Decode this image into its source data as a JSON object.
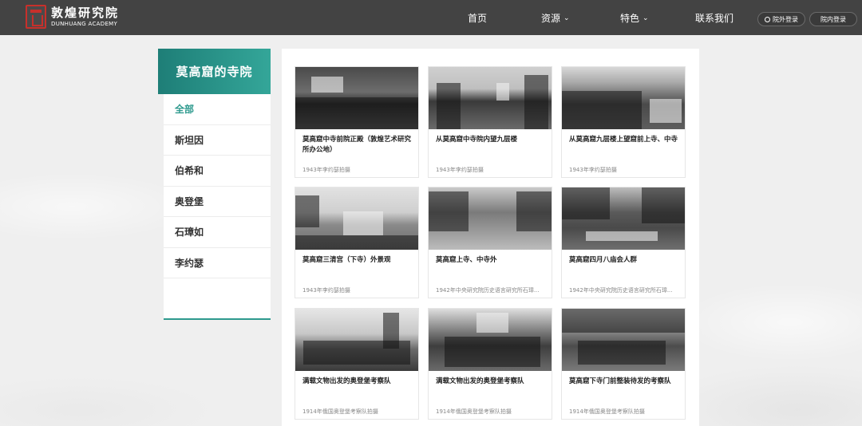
{
  "header": {
    "logo_cn": "敦煌研究院",
    "logo_en": "DUNHUANG ACADEMY",
    "nav": [
      {
        "label": "首页",
        "has_dropdown": false
      },
      {
        "label": "资源",
        "has_dropdown": true
      },
      {
        "label": "特色",
        "has_dropdown": true
      },
      {
        "label": "联系我们",
        "has_dropdown": false
      }
    ],
    "login_external": "院外登录",
    "login_internal": "院内登录"
  },
  "sidebar": {
    "title": "莫高窟的寺院",
    "items": [
      {
        "label": "全部",
        "active": true
      },
      {
        "label": "斯坦因",
        "active": false
      },
      {
        "label": "伯希和",
        "active": false
      },
      {
        "label": "奥登堡",
        "active": false
      },
      {
        "label": "石璋如",
        "active": false
      },
      {
        "label": "李约瑟",
        "active": false
      }
    ]
  },
  "cards": [
    {
      "title": "莫高窟中寺前院正殿（敦煌艺术研究所办公地）",
      "meta": "1943年李约瑟拍摄",
      "photo": "p1"
    },
    {
      "title": "从莫高窟中寺院内望九层楼",
      "meta": "1943年李约瑟拍摄",
      "photo": "p2"
    },
    {
      "title": "从莫高窟九层楼上望窟前上寺、中寺",
      "meta": "1943年李约瑟拍摄",
      "photo": "p3"
    },
    {
      "title": "莫高窟三清宫（下寺）外景观",
      "meta": "1943年李约瑟拍摄",
      "photo": "p4"
    },
    {
      "title": "莫高窟上寺、中寺外",
      "meta": "1942年中央研究院历史语言研究所石璋...",
      "photo": "p5"
    },
    {
      "title": "莫高窟四月八庙会人群",
      "meta": "1942年中央研究院历史语言研究所石璋...",
      "photo": "p6"
    },
    {
      "title": "满载文物出发的奥登堡考察队",
      "meta": "1914年俄国奥登堡考察队拍摄",
      "photo": "p7"
    },
    {
      "title": "满载文物出发的奥登堡考察队",
      "meta": "1914年俄国奥登堡考察队拍摄",
      "photo": "p8"
    },
    {
      "title": "莫高窟下寺门前整装待发的考察队",
      "meta": "1914年俄国奥登堡考察队拍摄",
      "photo": "p9"
    }
  ],
  "colors": {
    "header_bg": "#434343",
    "accent_teal": "#2e9a8e",
    "logo_red": "#c7302b"
  }
}
